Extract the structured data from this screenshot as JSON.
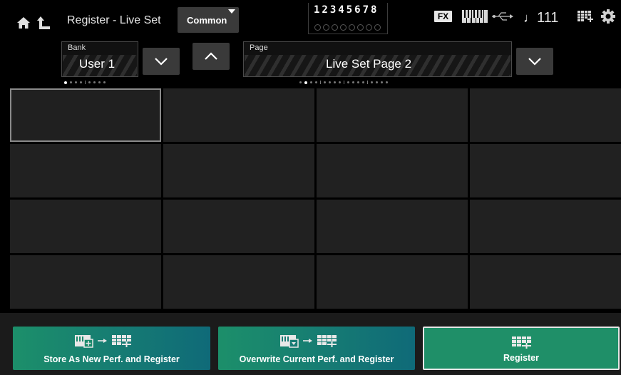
{
  "header": {
    "title": "Register - Live Set",
    "common_label": "Common",
    "parts": "12345678",
    "fx_label": "FX",
    "tempo_value": "111",
    "icons": [
      "home-icon",
      "up-icon",
      "keyboard-icon",
      "usb-icon",
      "note-icon",
      "grid-icon",
      "gear-icon"
    ]
  },
  "bank": {
    "label": "Bank",
    "value": "User 1"
  },
  "page": {
    "label": "Page",
    "value": "Live Set Page  2"
  },
  "grid": {
    "rows": 4,
    "columns": 4,
    "selected_slot": 1
  },
  "actions": {
    "store_new": "Store As New Perf. and Register",
    "overwrite": "Overwrite Current Perf. and Register",
    "register": "Register"
  },
  "colors": {
    "accent_teal": "#167b73",
    "accent_green": "#1f8f68",
    "cell_bg": "#212121",
    "button_bg": "#3a3a3a"
  }
}
